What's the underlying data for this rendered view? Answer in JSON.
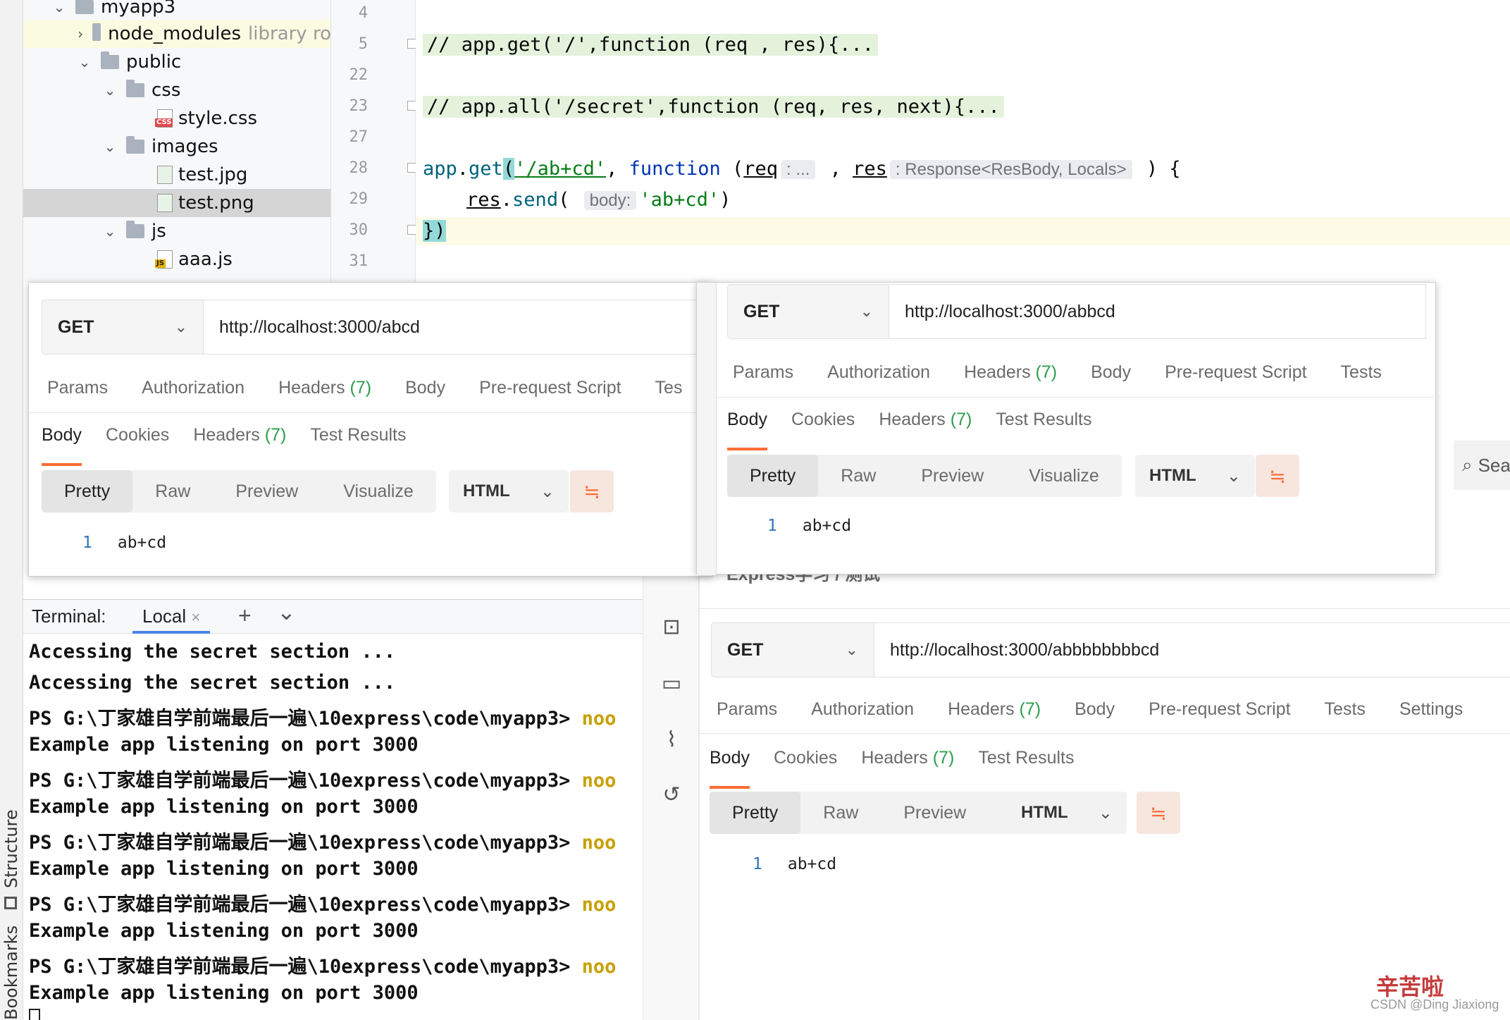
{
  "ide": {
    "side_labels": {
      "structure": "Structure",
      "bookmarks": "Bookmarks"
    },
    "tree": [
      {
        "label": "myapp3",
        "type": "folder",
        "expanded": true
      },
      {
        "label": "node_modules",
        "type": "folder",
        "note": "library ro",
        "expanded": false
      },
      {
        "label": "public",
        "type": "folder",
        "expanded": true
      },
      {
        "label": "css",
        "type": "folder",
        "expanded": true
      },
      {
        "label": "style.css",
        "type": "file",
        "tag": "CSS"
      },
      {
        "label": "images",
        "type": "folder",
        "expanded": true
      },
      {
        "label": "test.jpg",
        "type": "file",
        "tag": ""
      },
      {
        "label": "test.png",
        "type": "file",
        "tag": "",
        "selected": true
      },
      {
        "label": "js",
        "type": "folder",
        "expanded": true
      },
      {
        "label": "aaa.js",
        "type": "file",
        "tag": "JS"
      }
    ],
    "line_numbers": [
      "4",
      "5",
      "22",
      "23",
      "27",
      "28",
      "29",
      "30",
      "31"
    ],
    "code": {
      "line5": "// app.get('/',function (req , res){...",
      "line23": "// app.all('/secret',function (req, res, next){...",
      "line28": {
        "obj": "app",
        "dot": ".",
        "method": "get",
        "open": "(",
        "route": "'/ab+cd'",
        "comma1": ", ",
        "kw": "function",
        "space": " (",
        "p1": "req",
        "hint1": ": ...",
        "comma2": " , ",
        "p2": "res",
        "hint2": ": Response<ResBody, Locals>",
        "close": " ) {"
      },
      "line29": {
        "obj": "res",
        "dot": ".",
        "method": "send",
        "open": "( ",
        "hint": "body:",
        "arg": "'ab+cd'",
        "close": ")"
      },
      "line30": "})"
    },
    "terminal": {
      "title": "Terminal:",
      "tab": "Local",
      "close": "×",
      "add": "+",
      "more": "⌄",
      "lines": [
        {
          "text": "Accessing the secret section ...",
          "cmd": ""
        },
        {
          "text": "Accessing the secret section ...",
          "cmd": ""
        },
        {
          "text": "PS G:\\丁家雄自学前端最后一遍\\10express\\code\\myapp3> ",
          "cmd": "noo"
        },
        {
          "text": "Example app listening on port 3000",
          "cmd": ""
        },
        {
          "text": "PS G:\\丁家雄自学前端最后一遍\\10express\\code\\myapp3> ",
          "cmd": "noo"
        },
        {
          "text": "Example app listening on port 3000",
          "cmd": ""
        },
        {
          "text": "PS G:\\丁家雄自学前端最后一遍\\10express\\code\\myapp3> ",
          "cmd": "noo"
        },
        {
          "text": "Example app listening on port 3000",
          "cmd": ""
        },
        {
          "text": "PS G:\\丁家雄自学前端最后一遍\\10express\\code\\myapp3> ",
          "cmd": "noo"
        },
        {
          "text": "Example app listening on port 3000",
          "cmd": ""
        },
        {
          "text": "PS G:\\丁家雄自学前端最后一遍\\10express\\code\\myapp3> ",
          "cmd": "noo"
        },
        {
          "text": "Example app listening on port 3000",
          "cmd": ""
        }
      ]
    }
  },
  "postman": {
    "breadcrumb": "Express学习 / 测试",
    "search_label": "Sea",
    "panels": [
      {
        "method": "GET",
        "url": "http://localhost:3000/abcd",
        "tabs": [
          "Params",
          "Authorization",
          "Headers",
          "Body",
          "Pre-request Script",
          "Tes"
        ],
        "headers_count": "(7)",
        "subtabs": [
          "Body",
          "Cookies",
          "Headers",
          "Test Results"
        ],
        "view_modes": [
          "Pretty",
          "Raw",
          "Preview",
          "Visualize"
        ],
        "format": "HTML",
        "response_line_no": "1",
        "response": "ab+cd"
      },
      {
        "method": "GET",
        "url": "http://localhost:3000/abbcd",
        "tabs": [
          "Params",
          "Authorization",
          "Headers",
          "Body",
          "Pre-request Script",
          "Tests"
        ],
        "headers_count": "(7)",
        "subtabs": [
          "Body",
          "Cookies",
          "Headers",
          "Test Results"
        ],
        "view_modes": [
          "Pretty",
          "Raw",
          "Preview",
          "Visualize"
        ],
        "format": "HTML",
        "response_line_no": "1",
        "response": "ab+cd"
      },
      {
        "method": "GET",
        "url": "http://localhost:3000/abbbbbbbbcd",
        "tabs": [
          "Params",
          "Authorization",
          "Headers",
          "Body",
          "Pre-request Script",
          "Tests",
          "Settings"
        ],
        "headers_count": "(7)",
        "subtabs": [
          "Body",
          "Cookies",
          "Headers",
          "Test Results"
        ],
        "view_modes": [
          "Pretty",
          "Raw",
          "Preview",
          "Visualize"
        ],
        "format": "HTML",
        "response_line_no": "1",
        "response": "ab+cd"
      }
    ]
  },
  "watermark": {
    "sticker": "辛苦啦",
    "credit": "CSDN @Ding Jiaxiong"
  },
  "colors": {
    "accent": "#ff6c37",
    "count_green": "#2d9d4c",
    "fold_bg": "#e4f2dc"
  }
}
